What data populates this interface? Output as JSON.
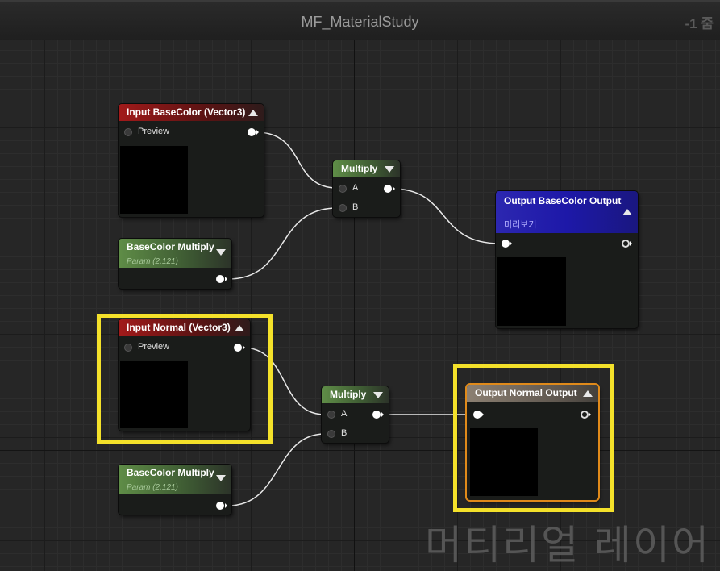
{
  "graph": {
    "title": "MF_MaterialStudy",
    "zoom": "-1 줌"
  },
  "nodes": {
    "input_basecolor": {
      "title": "Input BaseColor (Vector3)",
      "pin_preview": "Preview"
    },
    "basecolor_multiply_1": {
      "title": "BaseColor Multiply",
      "subtitle": "Param (2.121)"
    },
    "multiply_1": {
      "title": "Multiply",
      "pin_a": "A",
      "pin_b": "B"
    },
    "output_basecolor": {
      "title": "Output BaseColor Output",
      "subtitle": "미리보기"
    },
    "input_normal": {
      "title": "Input Normal (Vector3)",
      "pin_preview": "Preview"
    },
    "basecolor_multiply_2": {
      "title": "BaseColor Multiply",
      "subtitle": "Param (2.121)"
    },
    "multiply_2": {
      "title": "Multiply",
      "pin_a": "A",
      "pin_b": "B"
    },
    "output_normal": {
      "title": "Output Normal Output"
    }
  },
  "colors": {
    "highlight": "#f4e12a",
    "selected_border": "#e08a1a"
  },
  "watermark": "머티리얼 레이어"
}
